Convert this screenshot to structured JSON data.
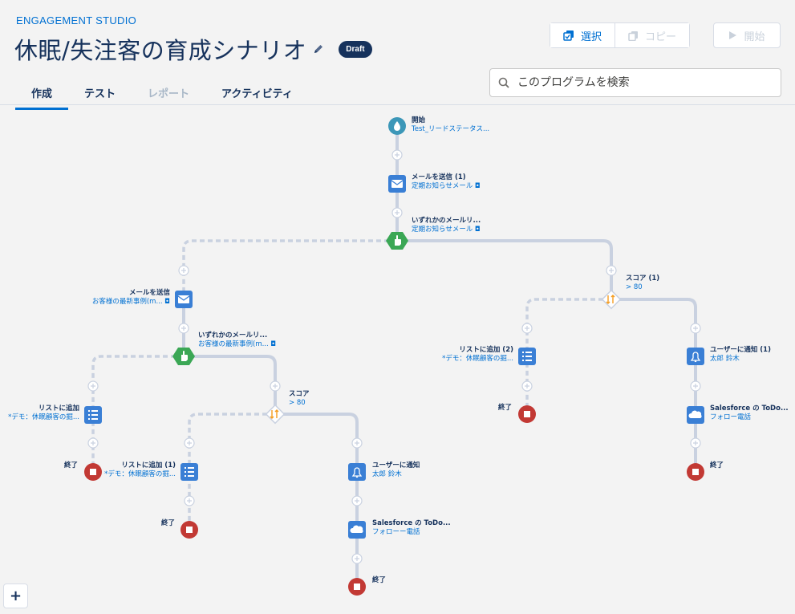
{
  "app": {
    "studio_label": "ENGAGEMENT STUDIO",
    "title": "休眠/失注客の育成シナリオ",
    "status_badge": "Draft"
  },
  "toolbar": {
    "select_label": "選択",
    "copy_label": "コピー",
    "start_label": "開始"
  },
  "tabs": [
    {
      "label": "作成",
      "active": true
    },
    {
      "label": "テスト",
      "active": false
    },
    {
      "label": "レポート",
      "active": false,
      "disabled": true
    },
    {
      "label": "アクティビティ",
      "active": false
    }
  ],
  "search": {
    "placeholder": "このプログラムを検索"
  },
  "zoom": {
    "in_label": "+"
  },
  "flow": {
    "start": {
      "title": "開始",
      "sub": "Test_リードステータス..."
    },
    "email1": {
      "title": "メールを送信 (1)",
      "sub": "定期お知らせメール"
    },
    "trigger1": {
      "title": "いずれかのメールリ...",
      "sub": "定期お知らせメール"
    },
    "email2": {
      "title": "メールを送信",
      "sub": "お客様の最新事例(m..."
    },
    "trigger2": {
      "title": "いずれかのメールリ...",
      "sub": "お客様の最新事例(m..."
    },
    "score1": {
      "title": "スコア (1)",
      "sub": "> 80"
    },
    "score2": {
      "title": "スコア",
      "sub": "> 80"
    },
    "list_add_a": {
      "title": "リストに追加",
      "sub": "*デモ：休眠顧客の掘..."
    },
    "list_add_b": {
      "title": "リストに追加 (1)",
      "sub": "*デモ：休眠顧客の掘..."
    },
    "list_add_c": {
      "title": "リストに追加 (2)",
      "sub": "*デモ：休眠顧客の掘..."
    },
    "notify_a": {
      "title": "ユーザーに通知",
      "sub": "太郎 鈴木"
    },
    "notify_b": {
      "title": "ユーザーに通知 (1)",
      "sub": "太郎 鈴木"
    },
    "sf_a": {
      "title": "Salesforce の ToDo...",
      "sub": "フォローー電話"
    },
    "sf_b": {
      "title": "Salesforce の ToDo...",
      "sub": "フォロー電話"
    },
    "end_label": "終了"
  },
  "colors": {
    "accent": "#0070d2",
    "navy": "#16325c",
    "green": "#3ba755",
    "end_red": "#c23934",
    "connector": "#c9d1e0",
    "start_teal": "#3c97b8"
  }
}
